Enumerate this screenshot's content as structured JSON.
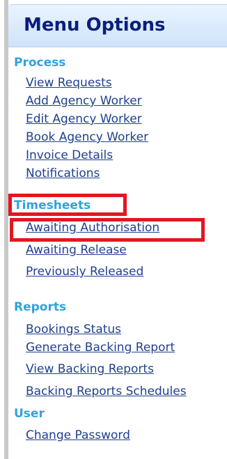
{
  "menu": {
    "title": "Menu Options",
    "sections": [
      {
        "label": "Process",
        "items": [
          "View Requests",
          "Add Agency Worker",
          "Edit Agency Worker",
          "Book Agency Worker",
          "Invoice Details",
          "Notifications"
        ]
      },
      {
        "label": "Timesheets",
        "items": [
          "Awaiting Authorisation",
          "Awaiting Release",
          "Previously Released"
        ]
      },
      {
        "label": "Reports",
        "items": [
          "Bookings Status",
          "Generate Backing Report",
          "View Backing Reports",
          "Backing Reports Schedules"
        ]
      },
      {
        "label": "User",
        "items": [
          "Change Password"
        ]
      }
    ]
  },
  "colors": {
    "title": "#0b1f7a",
    "section": "#30a3dc",
    "link": "#1f3f8f",
    "highlight": "#e3161f",
    "header_bg": "#dbeaff"
  }
}
